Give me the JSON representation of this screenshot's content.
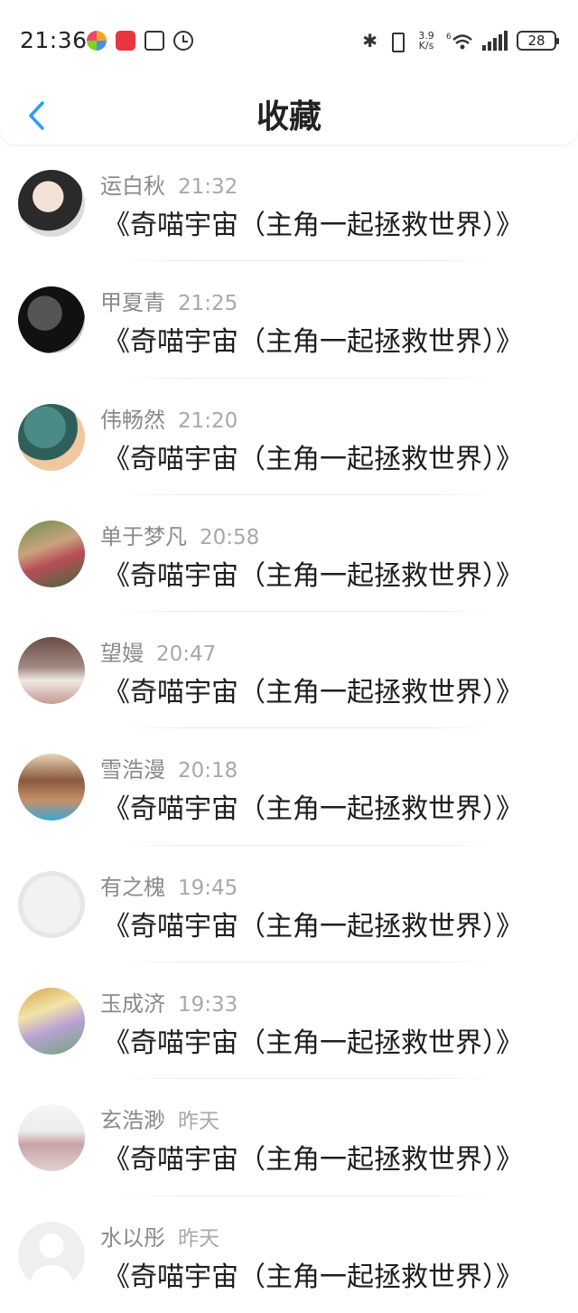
{
  "status_bar": {
    "time": "21:36",
    "net_speed_value": "3.9",
    "net_speed_unit": "K/s",
    "wifi_badge": "6",
    "battery_level": "28"
  },
  "header": {
    "title": "收藏"
  },
  "favorites": [
    {
      "name": "运白秋",
      "time": "21:32",
      "title": "《奇喵宇宙（主角一起拯救世界）》"
    },
    {
      "name": "甲夏青",
      "time": "21:25",
      "title": "《奇喵宇宙（主角一起拯救世界）》"
    },
    {
      "name": "伟畅然",
      "time": "21:20",
      "title": "《奇喵宇宙（主角一起拯救世界）》"
    },
    {
      "name": "单于梦凡",
      "time": "20:58",
      "title": "《奇喵宇宙（主角一起拯救世界）》"
    },
    {
      "name": "望嫚",
      "time": "20:47",
      "title": "《奇喵宇宙（主角一起拯救世界）》"
    },
    {
      "name": "雪浩漫",
      "time": "20:18",
      "title": "《奇喵宇宙（主角一起拯救世界）》"
    },
    {
      "name": "有之槐",
      "time": "19:45",
      "title": "《奇喵宇宙（主角一起拯救世界）》"
    },
    {
      "name": "玉成济",
      "time": "19:33",
      "title": "《奇喵宇宙（主角一起拯救世界）》"
    },
    {
      "name": "玄浩渺",
      "time": "昨天",
      "title": "《奇喵宇宙（主角一起拯救世界）》"
    },
    {
      "name": "水以彤",
      "time": "昨天",
      "title": "《奇喵宇宙（主角一起拯救世界）》"
    }
  ]
}
